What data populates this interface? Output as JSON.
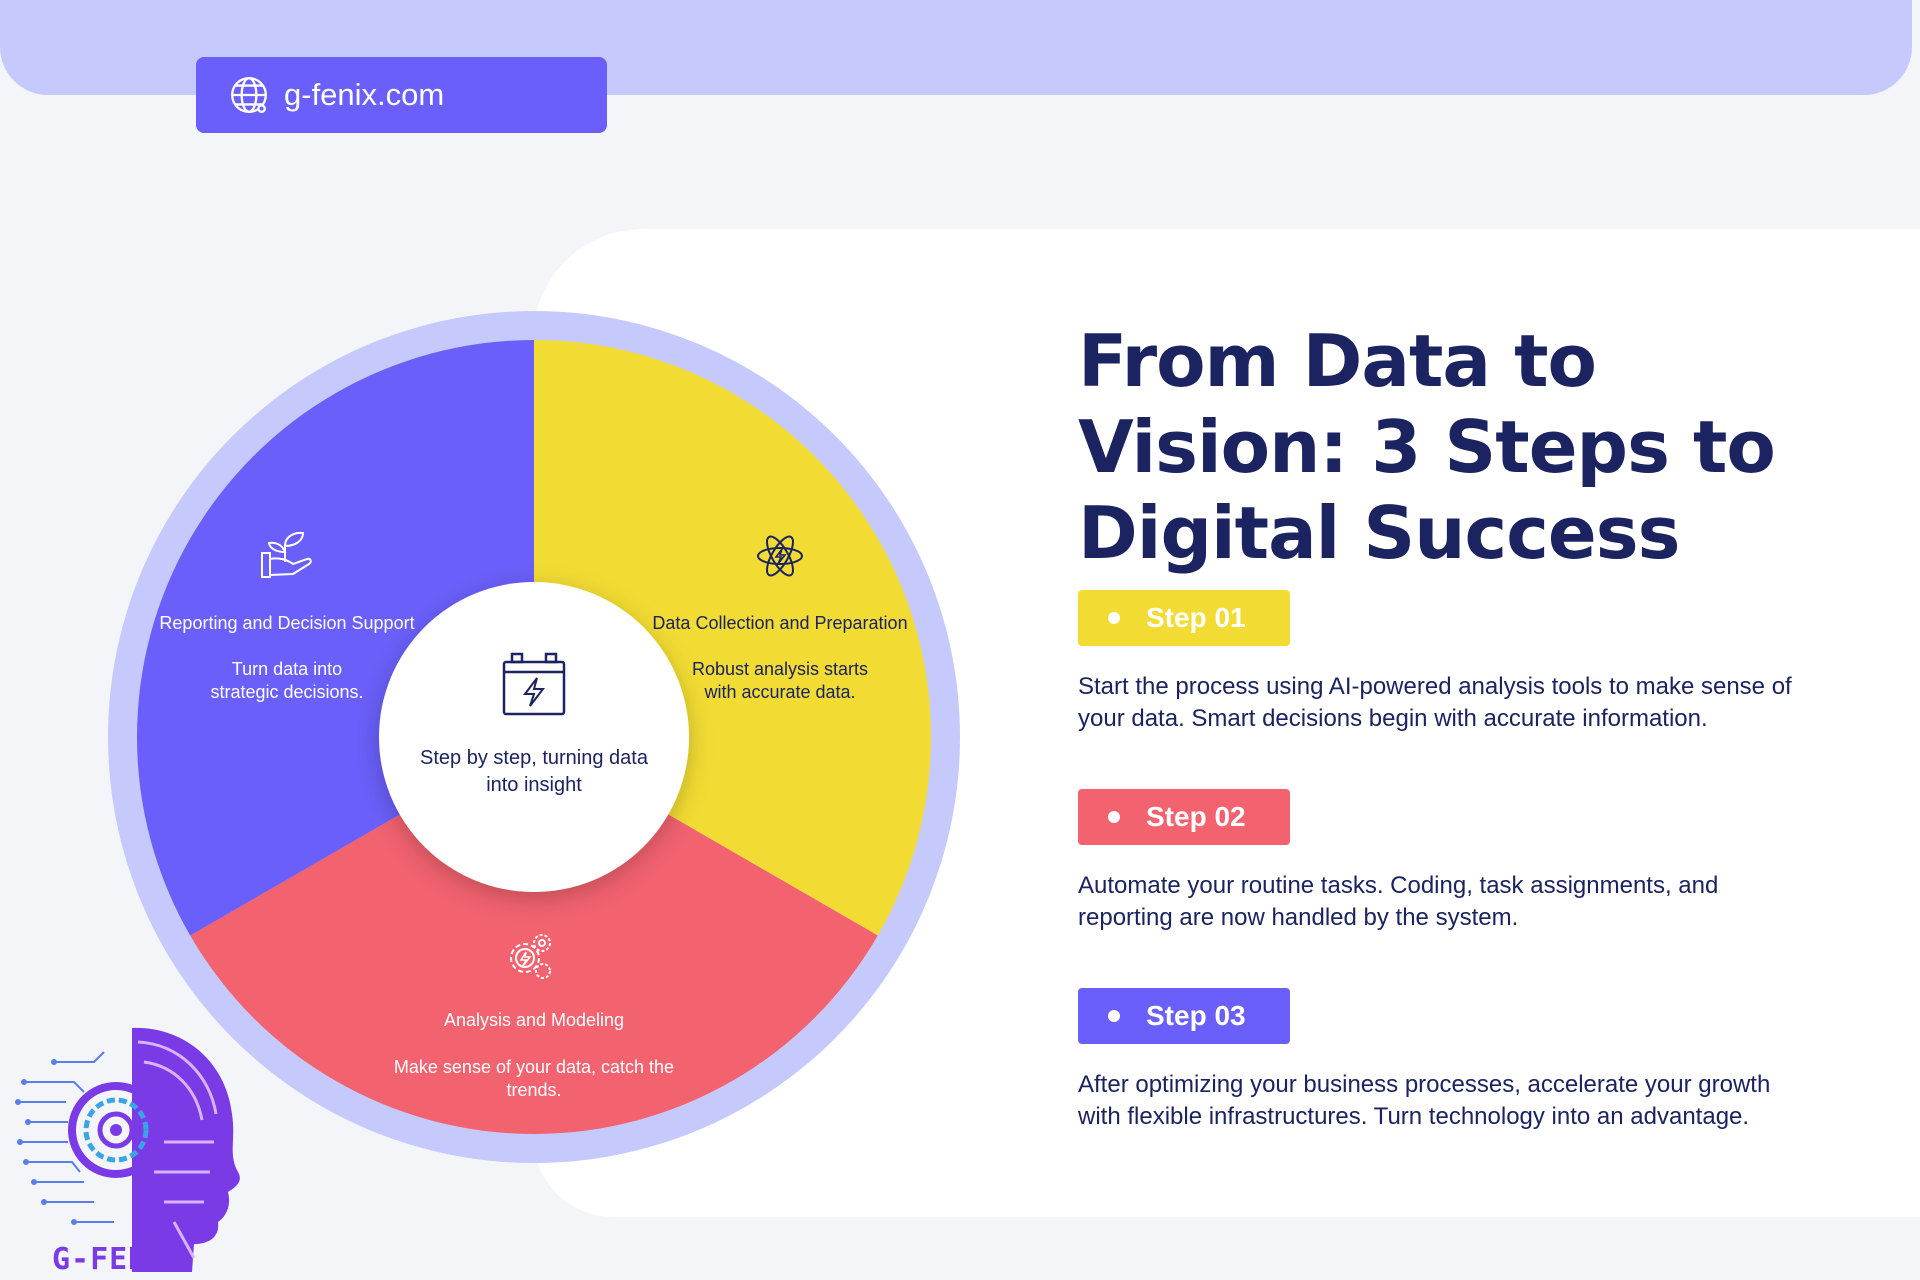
{
  "site": {
    "url_label": "g-fenix.com"
  },
  "title": "From Data to Vision: 3 Steps to Digital Success",
  "diagram": {
    "center_text": [
      "Step by step, turning data",
      "into insight"
    ],
    "segments": [
      {
        "title": "Data Collection and Preparation",
        "desc": [
          "Robust analysis starts",
          "with accurate data."
        ],
        "color": "#f2dc33",
        "icon": "atom-icon"
      },
      {
        "title": "Analysis and Modeling",
        "desc": [
          "Make sense of your data, catch the",
          "trends."
        ],
        "color": "#f2626f",
        "icon": "gears-icon"
      },
      {
        "title": "Reporting and Decision Support",
        "desc": [
          "Turn data into",
          "strategic decisions."
        ],
        "color": "#6a5ffa",
        "icon": "plant-hand-icon"
      }
    ],
    "ring_color": "#c6c9fc",
    "center_icon": "battery-bolt-icon"
  },
  "steps": [
    {
      "label": "Step 01",
      "color": "#f2dc33",
      "desc": "Start the process using AI-powered analysis tools to make sense of your data. Smart decisions begin with accurate information."
    },
    {
      "label": "Step 02",
      "color": "#f2626f",
      "desc": "Automate your routine tasks. Coding, task assignments, and reporting are now handled by the system."
    },
    {
      "label": "Step 03",
      "color": "#6a5ffa",
      "desc": "After optimizing your business processes, accelerate your growth with flexible infrastructures. Turn technology into an advantage."
    }
  ],
  "logo": {
    "text": "G-FENIX"
  }
}
